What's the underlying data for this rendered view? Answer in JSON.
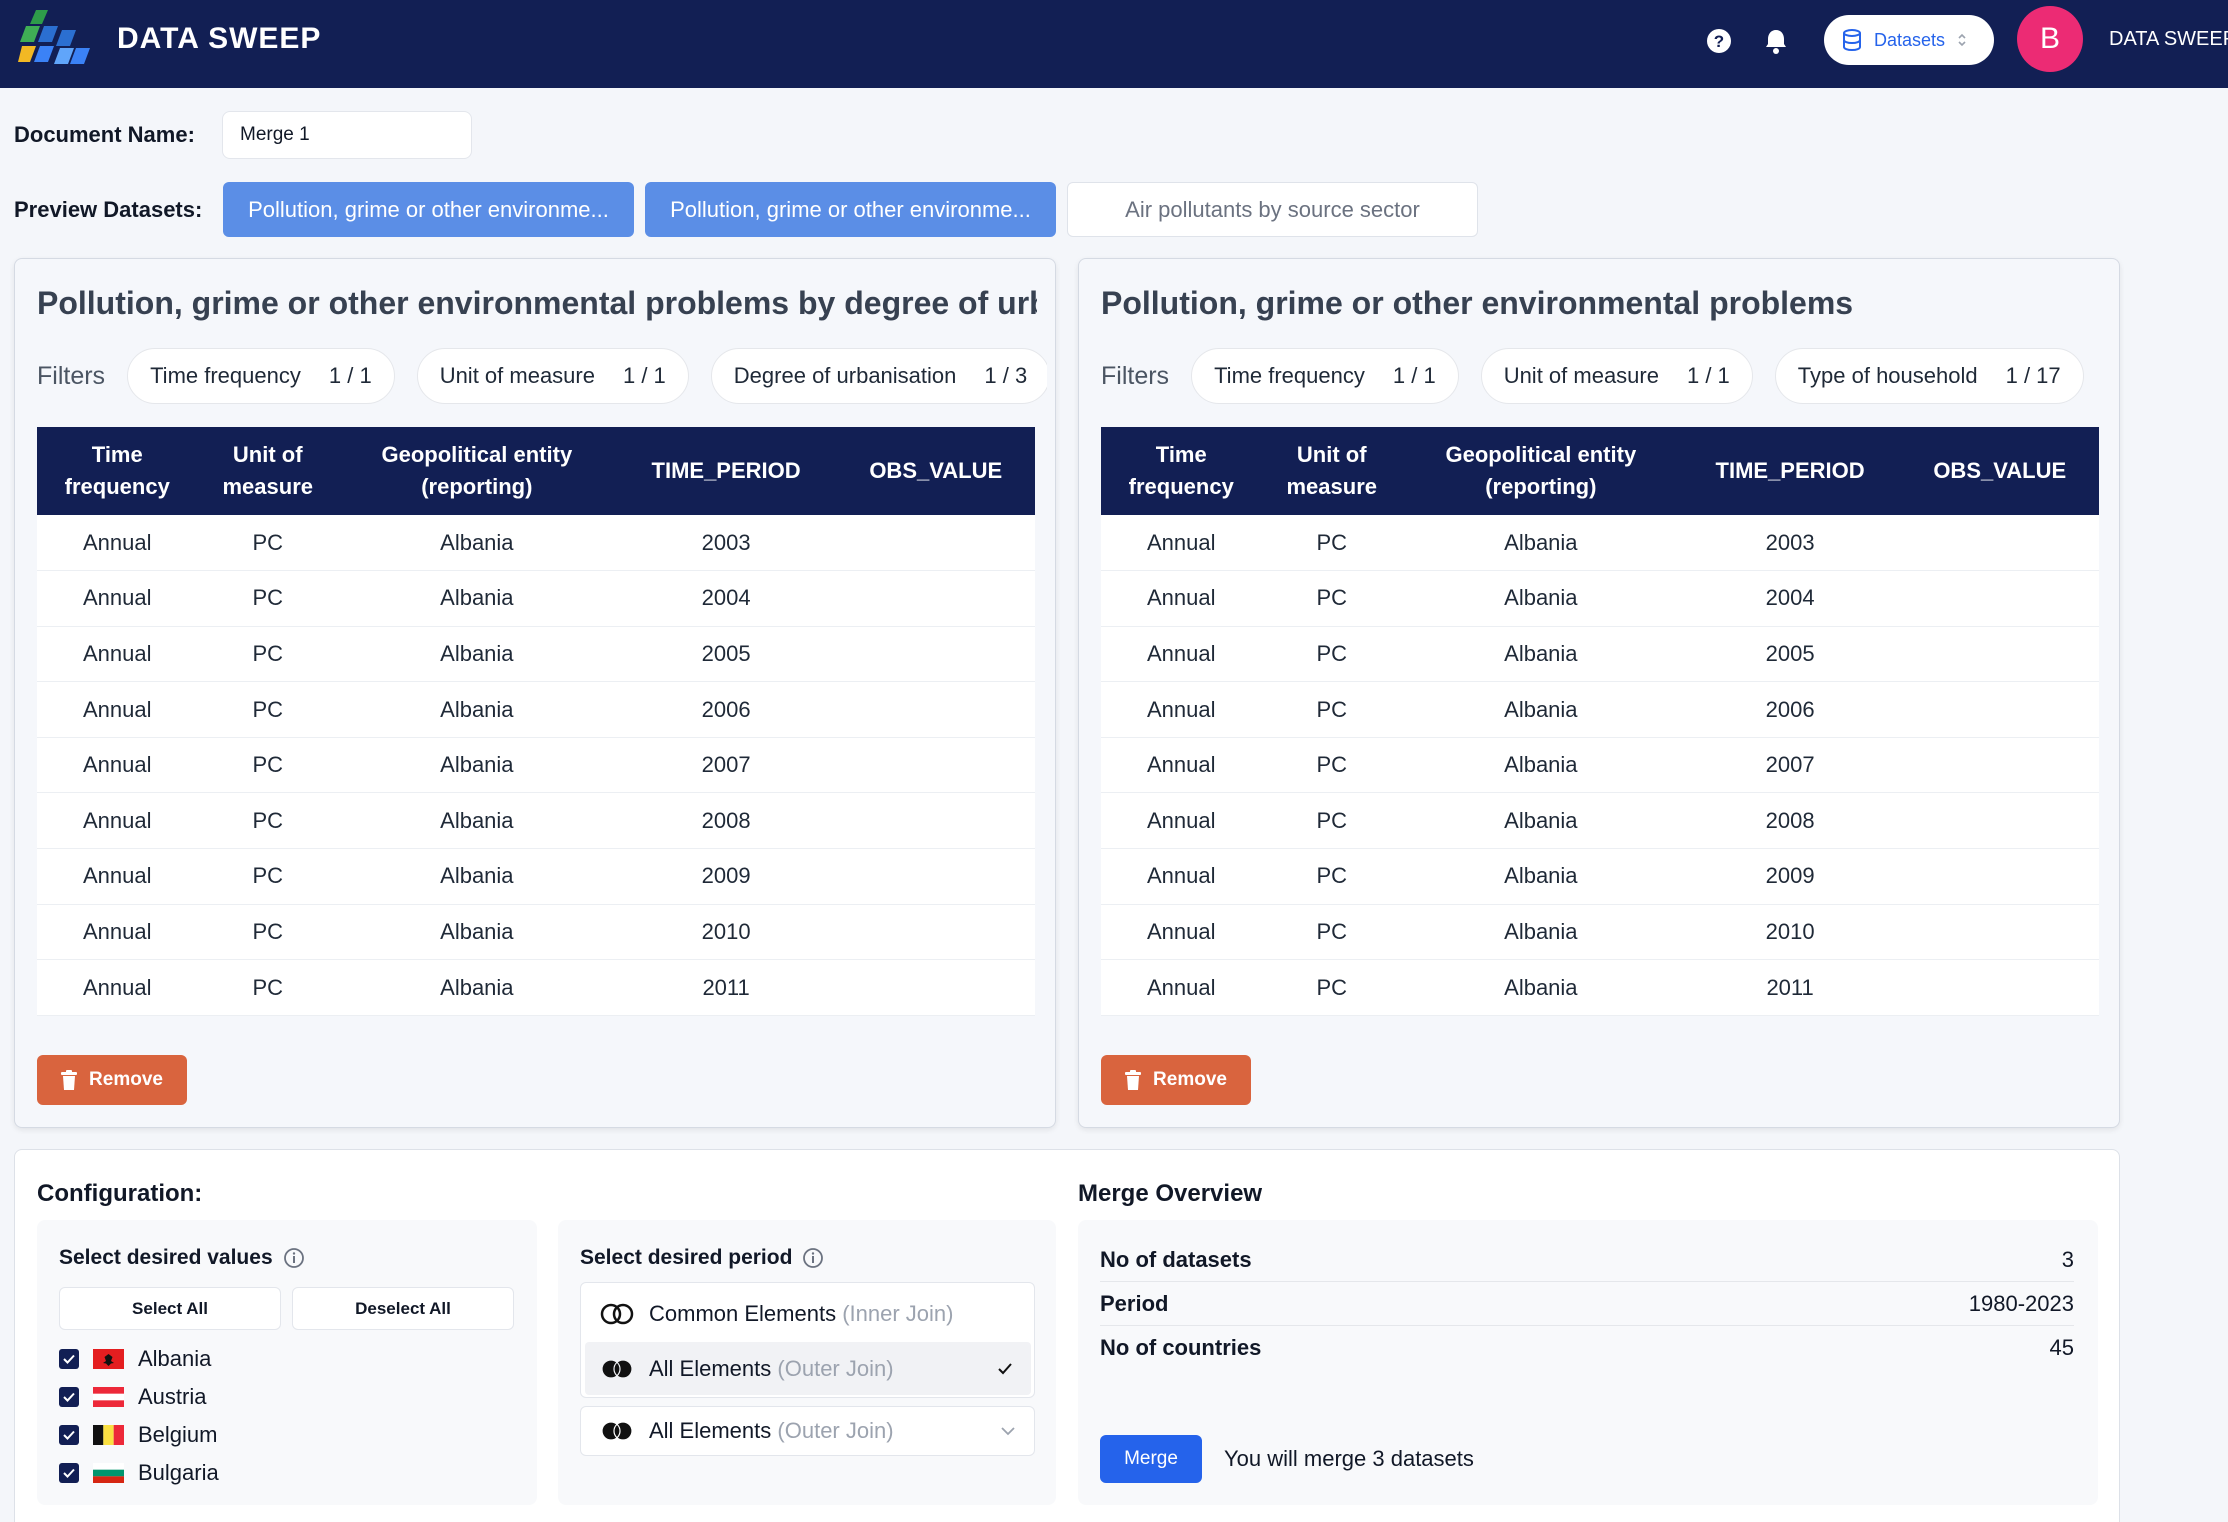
{
  "header": {
    "brand": "DATA SWEEP",
    "datasets_button": "Datasets",
    "avatar_letter": "B",
    "user_name": "DATA SWEEP"
  },
  "document": {
    "label": "Document Name:",
    "value": "Merge 1"
  },
  "preview": {
    "label": "Preview Datasets:",
    "tabs": [
      {
        "label": "Pollution, grime or other environme..."
      },
      {
        "label": "Pollution, grime or other environme..."
      },
      {
        "label": "Air pollutants by source sector"
      }
    ]
  },
  "panels": [
    {
      "title": "Pollution, grime or other environmental problems by degree of urb...",
      "filters_label": "Filters",
      "filters": [
        {
          "name": "Time frequency",
          "count": "1 / 1"
        },
        {
          "name": "Unit of measure",
          "count": "1 / 1"
        },
        {
          "name": "Degree of urbanisation",
          "count": "1 / 3"
        }
      ],
      "remove_label": "Remove"
    },
    {
      "title": "Pollution, grime or other environmental problems",
      "filters_label": "Filters",
      "filters": [
        {
          "name": "Time frequency",
          "count": "1 / 1"
        },
        {
          "name": "Unit of measure",
          "count": "1 / 1"
        },
        {
          "name": "Type of household",
          "count": "1 / 17"
        }
      ],
      "remove_label": "Remove"
    }
  ],
  "table": {
    "headers": [
      "Time\nfrequency",
      "Unit of\nmeasure",
      "Geopolitical entity\n(reporting)",
      "TIME_PERIOD",
      "OBS_VALUE"
    ],
    "rows": [
      [
        "Annual",
        "PC",
        "Albania",
        "2003",
        ""
      ],
      [
        "Annual",
        "PC",
        "Albania",
        "2004",
        ""
      ],
      [
        "Annual",
        "PC",
        "Albania",
        "2005",
        ""
      ],
      [
        "Annual",
        "PC",
        "Albania",
        "2006",
        ""
      ],
      [
        "Annual",
        "PC",
        "Albania",
        "2007",
        ""
      ],
      [
        "Annual",
        "PC",
        "Albania",
        "2008",
        ""
      ],
      [
        "Annual",
        "PC",
        "Albania",
        "2009",
        ""
      ],
      [
        "Annual",
        "PC",
        "Albania",
        "2010",
        ""
      ],
      [
        "Annual",
        "PC",
        "Albania",
        "2011",
        ""
      ]
    ]
  },
  "configuration": {
    "title": "Configuration:",
    "values_title": "Select desired values",
    "select_all": "Select All",
    "deselect_all": "Deselect All",
    "countries": [
      "Albania",
      "Austria",
      "Belgium",
      "Bulgaria"
    ],
    "period_title": "Select desired period",
    "join_options": [
      {
        "label": "Common Elements",
        "hint": "(Inner Join)"
      },
      {
        "label": "All Elements",
        "hint": "(Outer Join)"
      }
    ],
    "selected_join": {
      "label": "All Elements",
      "hint": "(Outer Join)"
    }
  },
  "overview": {
    "title": "Merge Overview",
    "rows": [
      {
        "key": "No of datasets",
        "value": "3"
      },
      {
        "key": "Period",
        "value": "1980-2023"
      },
      {
        "key": "No of countries",
        "value": "45"
      }
    ],
    "merge_button": "Merge",
    "note": "You will merge 3 datasets"
  },
  "colors": {
    "navy": "#121f54",
    "tab_active": "#5b8ee6",
    "remove": "#d9643e",
    "merge": "#2563eb",
    "avatar": "#ec2b74"
  },
  "icons": [
    "logo-icon",
    "help-icon",
    "bell-icon",
    "database-icon",
    "chevron-updown-icon",
    "trash-icon",
    "info-icon",
    "venn-icon",
    "check-icon",
    "chevron-down-icon"
  ]
}
